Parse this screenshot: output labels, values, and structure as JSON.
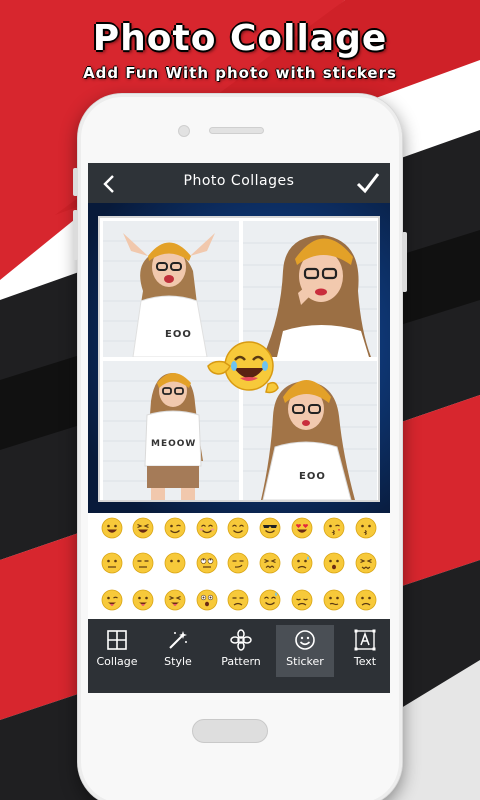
{
  "promo": {
    "title": "Photo Collage",
    "subtitle": "Add Fun With photo with stickers"
  },
  "app_bar": {
    "title": "Photo Collages",
    "back_icon": "chevron-left-icon",
    "done_icon": "checkmark-icon"
  },
  "collage": {
    "tiles": [
      {
        "shirt_text": "EOO"
      },
      {
        "shirt_text": ""
      },
      {
        "shirt_text": "MEOOW"
      },
      {
        "shirt_text": "EOO"
      }
    ],
    "sticker": "laughing-pointing-emoji"
  },
  "emoji_rows": [
    [
      "grinning",
      "laughing",
      "winking",
      "blushing",
      "smiling",
      "sunglasses",
      "heart-eyes",
      "kissing-wink",
      "kissing"
    ],
    [
      "neutral",
      "expressionless",
      "no-mouth",
      "eye-roll",
      "smirk",
      "persevering",
      "sweat",
      "hushed",
      "confounded"
    ],
    [
      "tongue-wink",
      "tongue",
      "tongue-closed-eyes",
      "surprised",
      "unamused",
      "sweat-smile",
      "pensive",
      "confused",
      "frowning"
    ]
  ],
  "toolbar": {
    "items": [
      {
        "label": "Collage",
        "icon": "grid-icon"
      },
      {
        "label": "Style",
        "icon": "magic-wand-icon"
      },
      {
        "label": "Pattern",
        "icon": "pattern-icon"
      },
      {
        "label": "Sticker",
        "icon": "smiley-icon"
      },
      {
        "label": "Text",
        "icon": "text-box-icon"
      }
    ],
    "active": "Sticker"
  },
  "colors": {
    "brand_red": "#d7262e",
    "dark": "#1f1f21",
    "toolbar": "#2d3136",
    "emoji_yellow": "#f7c93a"
  }
}
